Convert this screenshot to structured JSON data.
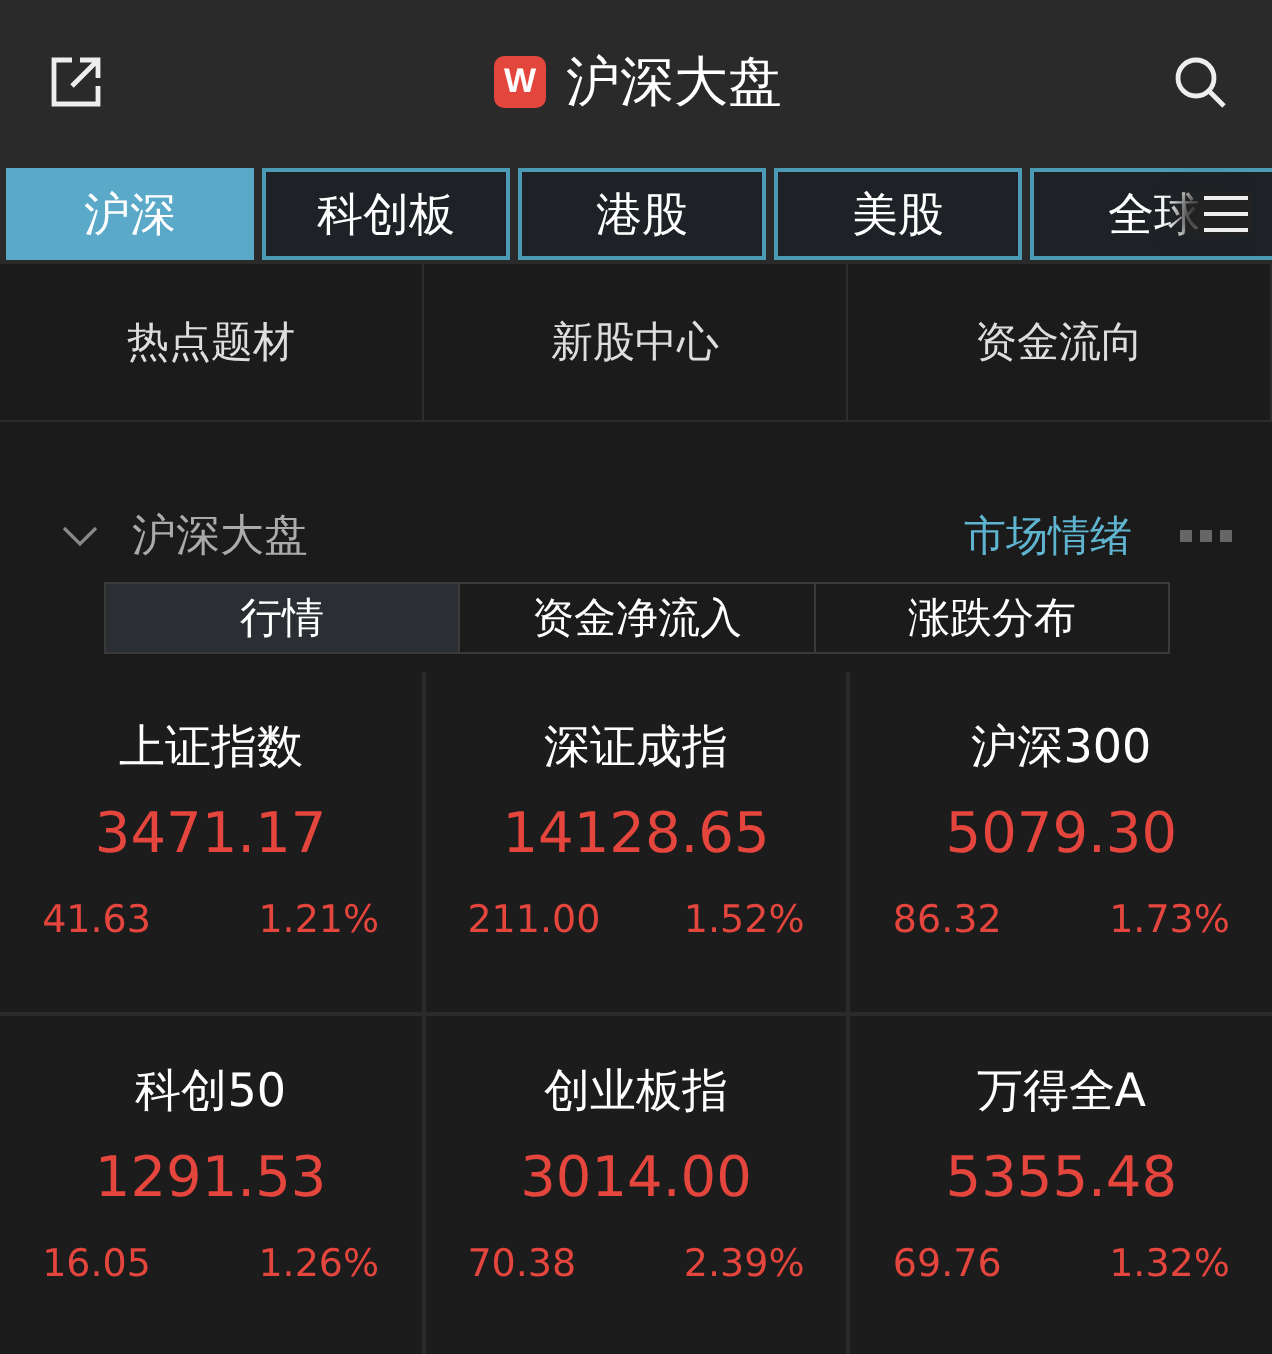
{
  "header": {
    "logo": "W",
    "title": "沪深大盘"
  },
  "market_tabs": [
    {
      "label": "沪深",
      "selected": true
    },
    {
      "label": "科创板",
      "selected": false
    },
    {
      "label": "港股",
      "selected": false
    },
    {
      "label": "美股",
      "selected": false
    },
    {
      "label": "全球",
      "selected": false
    }
  ],
  "shortcuts": [
    "热点题材",
    "新股中心",
    "资金流向"
  ],
  "section": {
    "title": "沪深大盘",
    "expanded": true,
    "link": "市场情绪"
  },
  "segments": [
    {
      "label": "行情",
      "selected": true
    },
    {
      "label": "资金净流入",
      "selected": false
    },
    {
      "label": "涨跌分布",
      "selected": false
    }
  ],
  "indices": [
    {
      "name": "上证指数",
      "value": "3471.17",
      "change": "41.63",
      "percent": "1.21%",
      "rising": true
    },
    {
      "name": "深证成指",
      "value": "14128.65",
      "change": "211.00",
      "percent": "1.52%",
      "rising": true
    },
    {
      "name": "沪深300",
      "value": "5079.30",
      "change": "86.32",
      "percent": "1.73%",
      "rising": true
    },
    {
      "name": "科创50",
      "value": "1291.53",
      "change": "16.05",
      "percent": "1.26%",
      "rising": true
    },
    {
      "name": "创业板指",
      "value": "3014.00",
      "change": "70.38",
      "percent": "2.39%",
      "rising": true
    },
    {
      "name": "万得全A",
      "value": "5355.48",
      "change": "69.76",
      "percent": "1.32%",
      "rising": true
    }
  ]
}
